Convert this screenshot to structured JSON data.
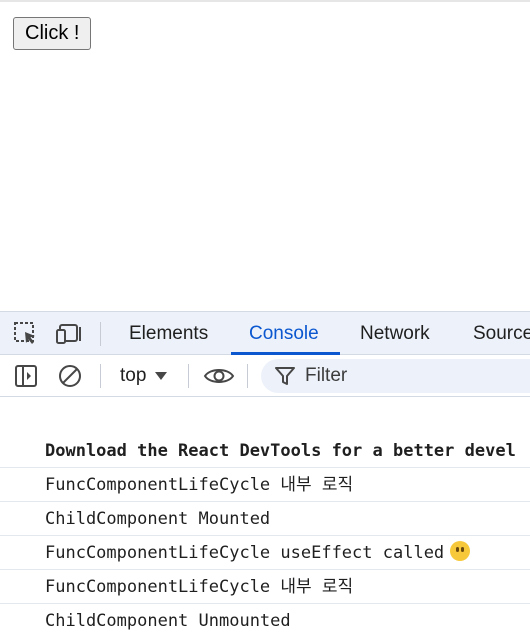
{
  "page": {
    "button_label": "Click !"
  },
  "devtools": {
    "tabs": [
      {
        "label": "Elements",
        "active": false
      },
      {
        "label": "Console",
        "active": true
      },
      {
        "label": "Network",
        "active": false
      },
      {
        "label": "Source",
        "active": false
      }
    ],
    "toolbar": {
      "context": "top",
      "filter_placeholder": "Filter"
    },
    "icons": [
      "inspect-element-icon",
      "device-toolbar-icon",
      "sidebar-toggle-icon",
      "clear-console-icon",
      "dropdown-arrow-icon",
      "eye-icon",
      "filter-icon"
    ],
    "accent_color": "#0b57d0",
    "console_messages": [
      {
        "text": "Download the React DevTools for a better devel",
        "bold": true
      },
      {
        "text": "FuncComponentLifeCycle 내부 로직",
        "bold": false
      },
      {
        "text": "ChildComponent Mounted",
        "bold": false
      },
      {
        "text": "FuncComponentLifeCycle useEffect called",
        "bold": false,
        "emoji": "emoji-face-icon"
      },
      {
        "text": "FuncComponentLifeCycle 내부 로직",
        "bold": false
      },
      {
        "text": "ChildComponent Unmounted",
        "bold": false
      }
    ]
  }
}
